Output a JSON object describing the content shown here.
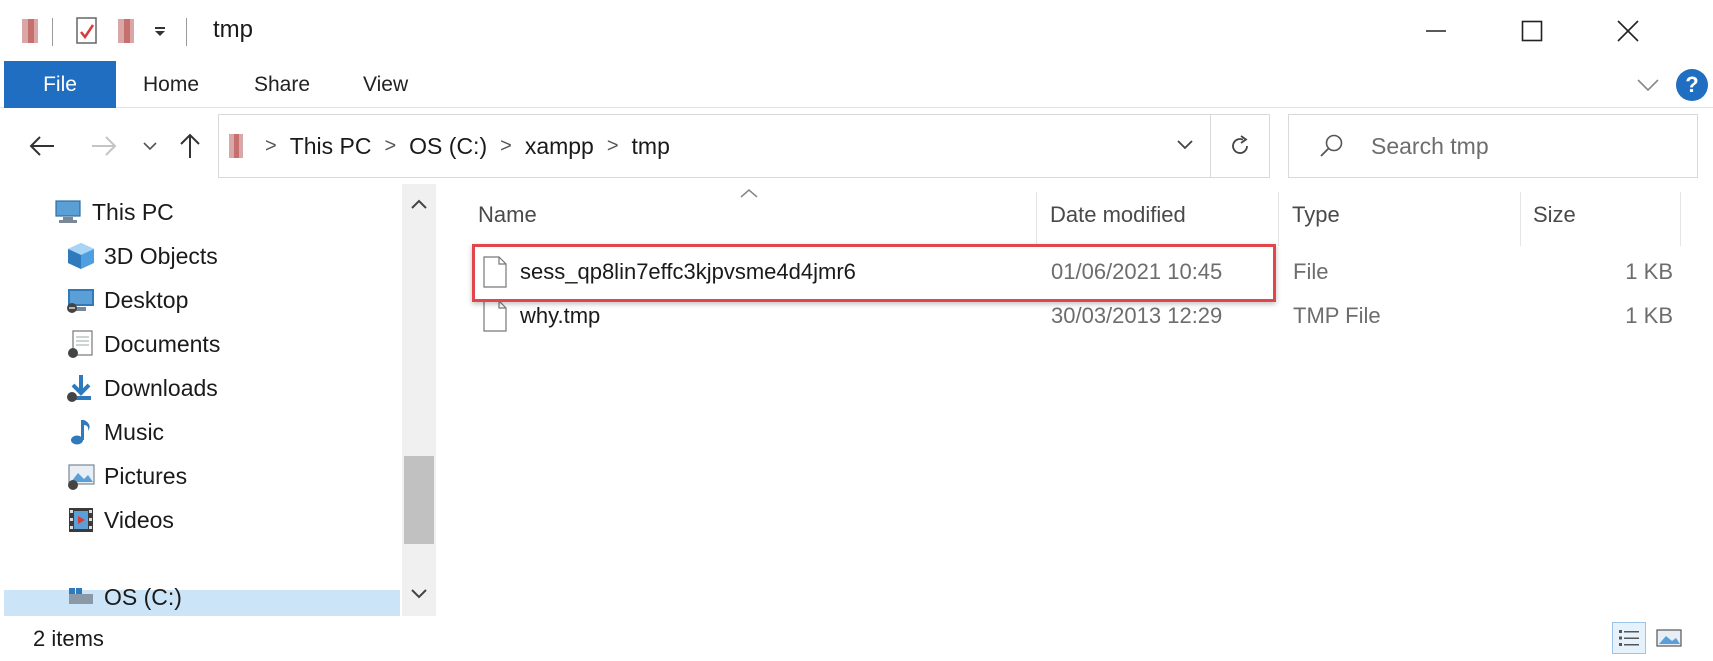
{
  "window": {
    "title": "tmp",
    "controls": {
      "minimize": "—",
      "maximize": "☐",
      "close": "✕"
    }
  },
  "ribbon": {
    "tabs": [
      {
        "label": "File",
        "active": true
      },
      {
        "label": "Home"
      },
      {
        "label": "Share"
      },
      {
        "label": "View"
      }
    ],
    "help_label": "?"
  },
  "address_bar": {
    "breadcrumbs": [
      "This PC",
      "OS (C:)",
      "xampp",
      "tmp"
    ]
  },
  "search": {
    "placeholder": "Search tmp"
  },
  "nav_pane": {
    "items": [
      {
        "label": "This PC",
        "icon": "pc-icon"
      },
      {
        "label": "3D Objects",
        "icon": "cube-icon"
      },
      {
        "label": "Desktop",
        "icon": "desktop-icon"
      },
      {
        "label": "Documents",
        "icon": "documents-icon"
      },
      {
        "label": "Downloads",
        "icon": "download-icon"
      },
      {
        "label": "Music",
        "icon": "music-note-icon"
      },
      {
        "label": "Pictures",
        "icon": "pictures-icon"
      },
      {
        "label": "Videos",
        "icon": "videos-icon"
      },
      {
        "label": "OS (C:)",
        "icon": "drive-icon"
      }
    ]
  },
  "file_list": {
    "columns": {
      "name": "Name",
      "date": "Date modified",
      "type": "Type",
      "size": "Size"
    },
    "rows": [
      {
        "name": "sess_qp8lin7effc3kjpvsme4d4jmr6",
        "date": "01/06/2021 10:45",
        "type": "File",
        "size": "1 KB",
        "highlighted": true
      },
      {
        "name": "why.tmp",
        "date": "30/03/2013 12:29",
        "type": "TMP File",
        "size": "1 KB"
      }
    ]
  },
  "status_bar": {
    "count": "2 items"
  },
  "colors": {
    "accent": "#1f6ec1",
    "highlight_border": "#e0474c",
    "folder_yellow": "#e8b93b"
  }
}
